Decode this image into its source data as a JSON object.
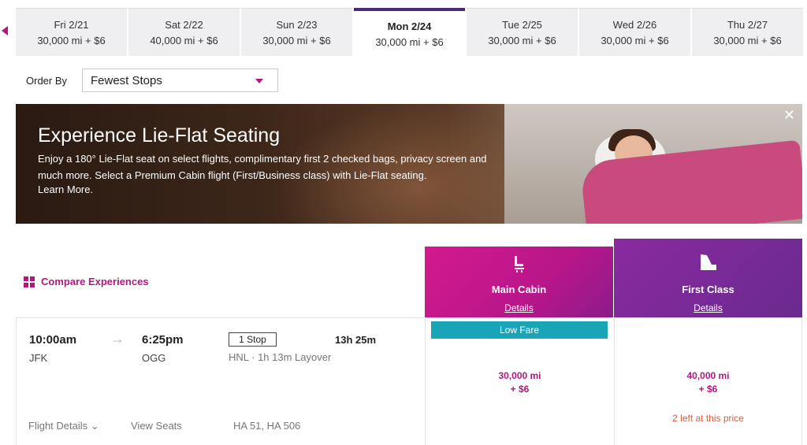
{
  "date_strip": {
    "dates": [
      {
        "day": "Fri 2/21",
        "price": "30,000 mi + $6"
      },
      {
        "day": "Sat 2/22",
        "price": "40,000 mi + $6"
      },
      {
        "day": "Sun 2/23",
        "price": "30,000 mi + $6"
      },
      {
        "day": "Mon 2/24",
        "price": "30,000 mi + $6"
      },
      {
        "day": "Tue 2/25",
        "price": "30,000 mi + $6"
      },
      {
        "day": "Wed 2/26",
        "price": "30,000 mi + $6"
      },
      {
        "day": "Thu 2/27",
        "price": "30,000 mi + $6"
      }
    ],
    "selected_index": 3
  },
  "order_by": {
    "label": "Order By",
    "value": "Fewest Stops"
  },
  "banner": {
    "title": "Experience Lie-Flat Seating",
    "body": "Enjoy a 180° Lie-Flat seat on select flights, complimentary first 2 checked bags, privacy screen and much more. Select a Premium Cabin flight (First/Business class) with Lie-Flat seating.",
    "link": "Learn More.",
    "close": "✕"
  },
  "compare": {
    "label": "Compare Experiences"
  },
  "cabins": {
    "main": {
      "name": "Main Cabin",
      "details": "Details",
      "color": "#c9198e"
    },
    "first": {
      "name": "First Class",
      "details": "Details",
      "color": "#7a2a96"
    }
  },
  "flight": {
    "depart_time": "10:00am",
    "depart_code": "JFK",
    "arrive_time": "6:25pm",
    "arrive_code": "OGG",
    "stops": "1 Stop",
    "layover": "HNL · 1h 13m Layover",
    "duration": "13h 25m",
    "flight_details": "Flight Details",
    "view_seats": "View Seats",
    "flight_numbers": "HA 51, HA 506",
    "main_fare": {
      "badge": "Low Fare",
      "miles": "30,000 mi",
      "tax": "+ $6"
    },
    "first_fare": {
      "miles": "40,000 mi",
      "tax": "+ $6",
      "availability": "2 left at this price"
    }
  },
  "colors": {
    "accent": "#b0187d",
    "low_fare_badge": "#19a5b8",
    "availability": "#d9603a",
    "active_tab_bar": "#4a2b7a"
  }
}
